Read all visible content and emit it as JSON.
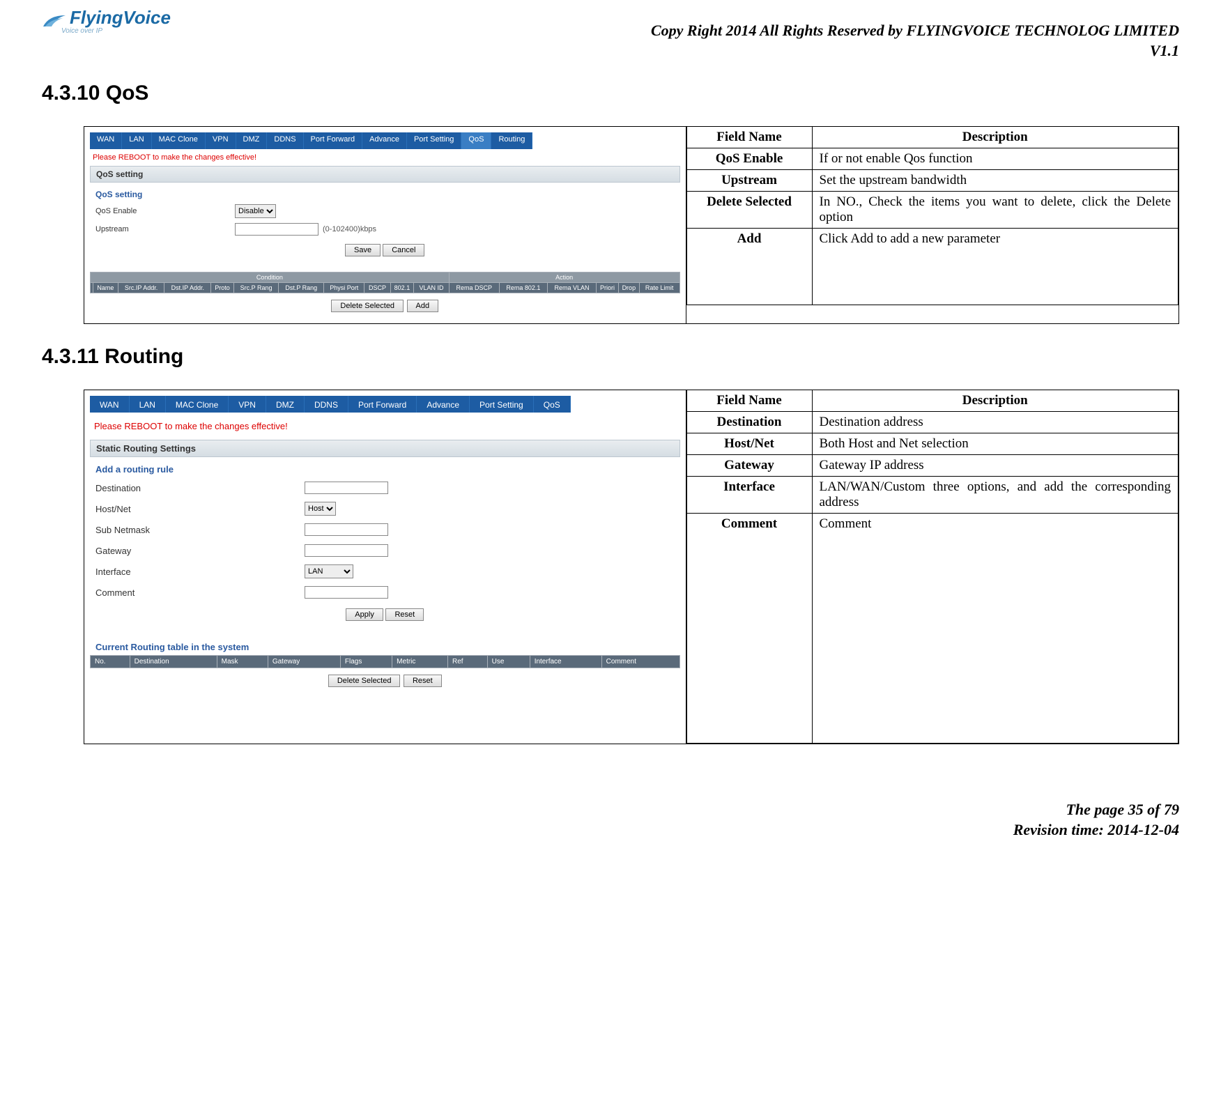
{
  "header": {
    "copyright": "Copy Right 2014 All Rights Reserved by FLYINGVOICE TECHNOLOG LIMITED",
    "version": "V1.1",
    "logo_main": "FlyingVoice",
    "logo_sub": "Voice over IP"
  },
  "section_qos": {
    "heading": "4.3.10  QoS",
    "table_head_field": "Field Name",
    "table_head_desc": "Description",
    "rows": [
      {
        "name": "QoS Enable",
        "desc": "If or not enable Qos function"
      },
      {
        "name": "Upstream",
        "desc": "Set the upstream bandwidth"
      },
      {
        "name": "Delete Selected",
        "desc": "In NO., Check the items you want to delete, click the Delete option",
        "justify": true
      },
      {
        "name": "Add",
        "desc": "Click Add to add a new parameter"
      }
    ],
    "ui": {
      "tabs": [
        "WAN",
        "LAN",
        "MAC Clone",
        "VPN",
        "DMZ",
        "DDNS",
        "Port Forward",
        "Advance",
        "Port Setting",
        "QoS",
        "Routing"
      ],
      "reboot": "Please REBOOT to make the changes effective!",
      "panel": "QoS setting",
      "sub": "QoS setting",
      "enable_label": "QoS Enable",
      "enable_value": "Disable",
      "upstream_label": "Upstream",
      "upstream_hint": "(0-102400)kbps",
      "save": "Save",
      "cancel": "Cancel",
      "group_condition": "Condition",
      "group_action": "Action",
      "cols": [
        "",
        "Name",
        "Src.IP Addr.",
        "Dst.IP Addr.",
        "Proto",
        "Src.P Rang",
        "Dst.P Rang",
        "Physi Port",
        "DSCP",
        "802.1",
        "VLAN ID",
        "Rema DSCP",
        "Rema 802.1",
        "Rema VLAN",
        "Priori",
        "Drop",
        "Rate Limit"
      ],
      "delete_selected": "Delete Selected",
      "add": "Add"
    }
  },
  "section_routing": {
    "heading": "4.3.11  Routing",
    "table_head_field": "Field Name",
    "table_head_desc": "Description",
    "rows": [
      {
        "name": "Destination",
        "desc": "Destination address"
      },
      {
        "name": "Host/Net",
        "desc": "Both Host and Net selection"
      },
      {
        "name": "Gateway",
        "desc": "Gateway IP address"
      },
      {
        "name": "Interface",
        "desc": "LAN/WAN/Custom three options, and add the corresponding address",
        "justify": true
      },
      {
        "name": "Comment",
        "desc": "Comment"
      }
    ],
    "ui": {
      "tabs": [
        "WAN",
        "LAN",
        "MAC Clone",
        "VPN",
        "DMZ",
        "DDNS",
        "Port Forward",
        "Advance",
        "Port Setting",
        "QoS"
      ],
      "reboot": "Please REBOOT to make the changes effective!",
      "panel": "Static Routing Settings",
      "sub": "Add a routing rule",
      "fields": {
        "dest": "Destination",
        "hostnet": "Host/Net",
        "hostnet_value": "Host",
        "subnet": "Sub Netmask",
        "gateway": "Gateway",
        "interface": "Interface",
        "interface_value": "LAN",
        "comment": "Comment"
      },
      "apply": "Apply",
      "reset": "Reset",
      "current_title": "Current Routing table in the system",
      "rt_cols": [
        "No.",
        "Destination",
        "Mask",
        "Gateway",
        "Flags",
        "Metric",
        "Ref",
        "Use",
        "Interface",
        "Comment"
      ],
      "delete_selected": "Delete Selected",
      "reset2": "Reset"
    }
  },
  "footer": {
    "page": "The page 35 of 79",
    "revision": "Revision time: 2014-12-04"
  }
}
